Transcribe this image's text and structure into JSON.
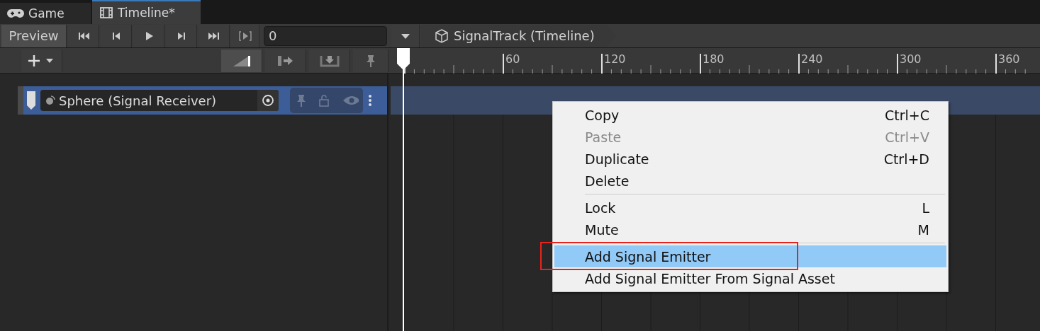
{
  "tabs": [
    {
      "label": "Game",
      "selected": false
    },
    {
      "label": "Timeline*",
      "selected": true
    }
  ],
  "toolbar": {
    "preview": {
      "label": "Preview",
      "on": true
    },
    "frame_field": {
      "value": "0"
    },
    "breadcrumb": "SignalTrack (Timeline)"
  },
  "ruler": {
    "ticks": [
      "60",
      "120",
      "180",
      "240",
      "300",
      "360"
    ]
  },
  "track": {
    "name": "Sphere (Signal Receiver)",
    "selected": true
  },
  "context_menu": {
    "items": [
      {
        "kind": "item",
        "label": "Copy",
        "shortcut": "Ctrl+C",
        "disabled": false,
        "selected": false
      },
      {
        "kind": "item",
        "label": "Paste",
        "shortcut": "Ctrl+V",
        "disabled": true,
        "selected": false
      },
      {
        "kind": "item",
        "label": "Duplicate",
        "shortcut": "Ctrl+D",
        "disabled": false,
        "selected": false
      },
      {
        "kind": "item",
        "label": "Delete",
        "disabled": false,
        "selected": false
      },
      {
        "kind": "separator"
      },
      {
        "kind": "item",
        "label": "Lock",
        "shortcut": "L",
        "disabled": false,
        "selected": false
      },
      {
        "kind": "item",
        "label": "Mute",
        "shortcut": "M",
        "disabled": false,
        "selected": false
      },
      {
        "kind": "separator"
      },
      {
        "kind": "item",
        "label": "Add Signal Emitter",
        "disabled": false,
        "selected": true
      },
      {
        "kind": "item",
        "label": "Add Signal Emitter From Signal Asset",
        "disabled": false,
        "selected": false
      }
    ]
  }
}
